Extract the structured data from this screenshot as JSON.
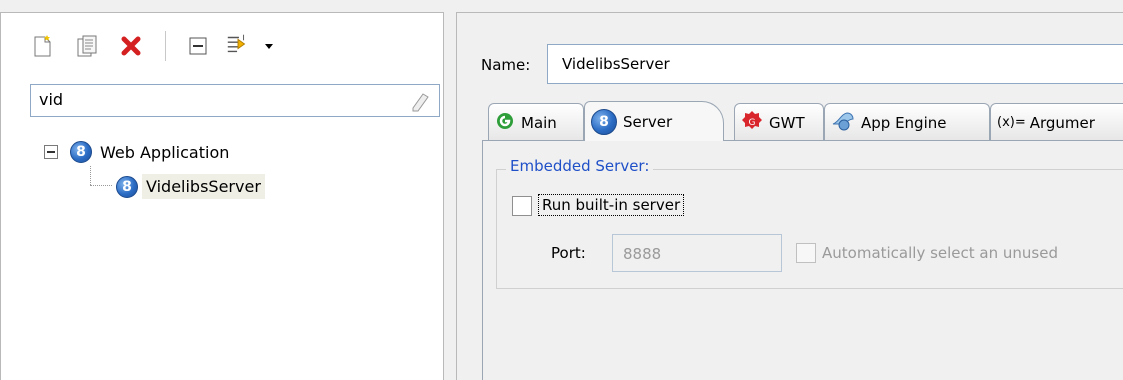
{
  "left": {
    "toolbar": {
      "icons": [
        "new-config-icon",
        "duplicate-icon",
        "delete-icon",
        "collapse-all-icon",
        "filter-icon",
        "dropdown-arrow-icon"
      ]
    },
    "filter": {
      "value": "vid"
    },
    "tree": {
      "root": {
        "label": "Web Application",
        "expanded_glyph": "⊟"
      },
      "child": {
        "label": "VidelibsServer"
      }
    }
  },
  "right": {
    "name_label": "Name:",
    "name_value": "VidelibsServer",
    "tabs": [
      {
        "label": "Main",
        "icon": "main-run-icon"
      },
      {
        "label": "Server",
        "icon": "server-globe-icon"
      },
      {
        "label": "GWT",
        "icon": "gwt-icon"
      },
      {
        "label": "App Engine",
        "icon": "app-engine-icon"
      },
      {
        "label": "Argumer",
        "icon": "arguments-icon",
        "prefix": "(x)="
      }
    ],
    "embedded_server": {
      "legend": "Embedded Server:",
      "run_checkbox_label": "Run built-in server",
      "run_checked": false,
      "port_label": "Port:",
      "port_value": "8888",
      "auto_select_label": "Automatically select an unused",
      "auto_select_checked": false
    }
  },
  "colors": {
    "accent_blue": "#1f50c8",
    "selection_bg": "#f0efe5",
    "delete_red": "#d42020"
  }
}
